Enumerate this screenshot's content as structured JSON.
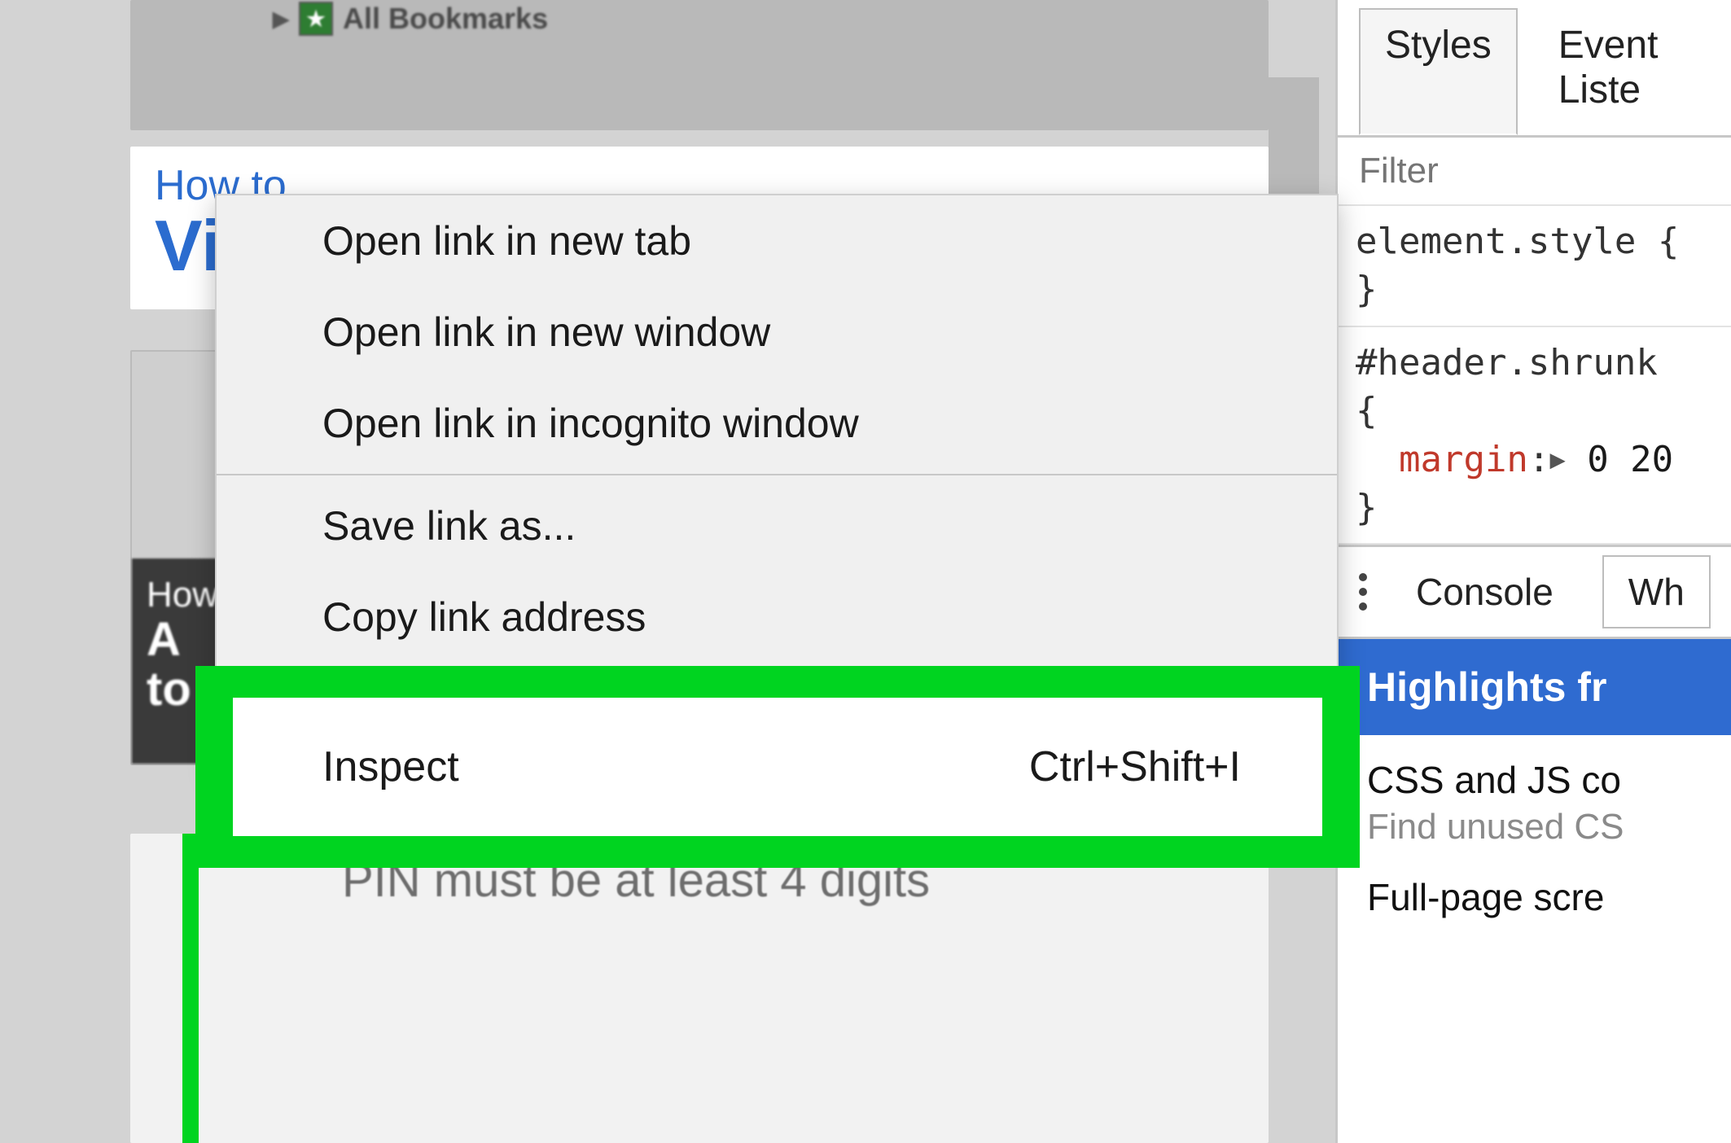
{
  "page": {
    "bookmarks_label": "All Bookmarks",
    "howto_eyebrow": "How to",
    "howto_title_fragment": "Vi",
    "thumb_line1": "How",
    "thumb_line2a": "A",
    "thumb_line2b": "to",
    "pin_message": "PIN must be at least 4 digits"
  },
  "context_menu": {
    "items": [
      {
        "label": "Open link in new tab",
        "shortcut": ""
      },
      {
        "label": "Open link in new window",
        "shortcut": ""
      },
      {
        "label": "Open link in incognito window",
        "shortcut": ""
      }
    ],
    "items2": [
      {
        "label": "Save link as...",
        "shortcut": ""
      },
      {
        "label": "Copy link address",
        "shortcut": ""
      }
    ],
    "inspect": {
      "label": "Inspect",
      "shortcut": "Ctrl+Shift+I"
    }
  },
  "devtools": {
    "tabs": {
      "styles": "Styles",
      "event_listeners": "Event Liste"
    },
    "filter_placeholder": "Filter",
    "style_block1_selector": "element.style {",
    "style_block1_close": "}",
    "style_block2_selector": "#header.shrunk",
    "style_block2_open": "{",
    "style_block2_prop": "margin",
    "style_block2_val": "0  20",
    "style_block2_close": "}",
    "drawer_tabs": {
      "console": "Console",
      "what": "Wh"
    },
    "banner": "Highlights fr",
    "suggestions": [
      {
        "title": "CSS and JS co",
        "sub": "Find unused CS"
      },
      {
        "title": "Full-page scre",
        "sub": ""
      }
    ]
  }
}
